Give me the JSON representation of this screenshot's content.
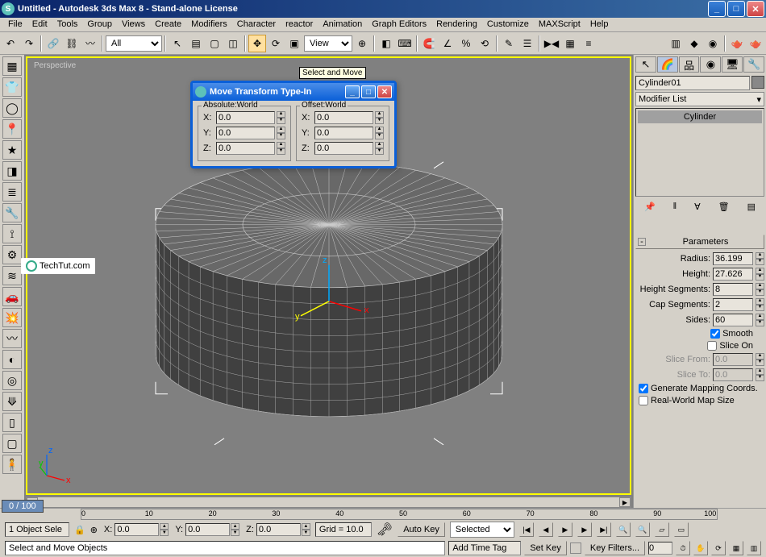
{
  "titlebar": {
    "title": "Untitled - Autodesk 3ds Max 8  - Stand-alone License"
  },
  "menu": [
    "File",
    "Edit",
    "Tools",
    "Group",
    "Views",
    "Create",
    "Modifiers",
    "Character",
    "reactor",
    "Animation",
    "Graph Editors",
    "Rendering",
    "Customize",
    "MAXScript",
    "Help"
  ],
  "toolbar": {
    "selection_filter": "All",
    "ref_coord": "View",
    "tooltip": "Select and Move"
  },
  "viewport": {
    "label": "Perspective"
  },
  "move_dialog": {
    "title": "Move Transform Type-In",
    "abs_label": "Absolute:World",
    "off_label": "Offset:World",
    "x_label": "X:",
    "y_label": "Y:",
    "z_label": "Z:",
    "abs": {
      "x": "0.0",
      "y": "0.0",
      "z": "0.0"
    },
    "off": {
      "x": "0.0",
      "y": "0.0",
      "z": "0.0"
    }
  },
  "right_panel": {
    "object_name": "Cylinder01",
    "modifier_list": "Modifier List",
    "stack_item": "Cylinder",
    "rollout_title": "Parameters",
    "params": {
      "radius_label": "Radius:",
      "radius": "36.199",
      "height_label": "Height:",
      "height": "27.626",
      "hseg_label": "Height Segments:",
      "hseg": "8",
      "cseg_label": "Cap Segments:",
      "cseg": "2",
      "sides_label": "Sides:",
      "sides": "60",
      "smooth_label": "Smooth",
      "sliceon_label": "Slice On",
      "slicefrom_label": "Slice From:",
      "slicefrom": "0.0",
      "sliceto_label": "Slice To:",
      "sliceto": "0.0",
      "genmap_label": "Generate Mapping Coords.",
      "realworld_label": "Real-World Map Size"
    }
  },
  "timeline": {
    "frame_counter": "0 / 100",
    "ticks": [
      "0",
      "10",
      "20",
      "30",
      "40",
      "50",
      "60",
      "70",
      "80",
      "90",
      "100"
    ]
  },
  "status": {
    "selection": "1 Object Sele",
    "x": "0.0",
    "y": "0.0",
    "z": "0.0",
    "grid": "Grid = 10.0",
    "prompt": "Select and Move Objects",
    "add_time_tag": "Add Time Tag",
    "autokey": "Auto Key",
    "setkey": "Set Key",
    "selected": "Selected",
    "keyfilters": "Key Filters...",
    "x_label": "X:",
    "y_label": "Y:",
    "z_label": "Z:"
  },
  "watermark": "TechTut.com"
}
